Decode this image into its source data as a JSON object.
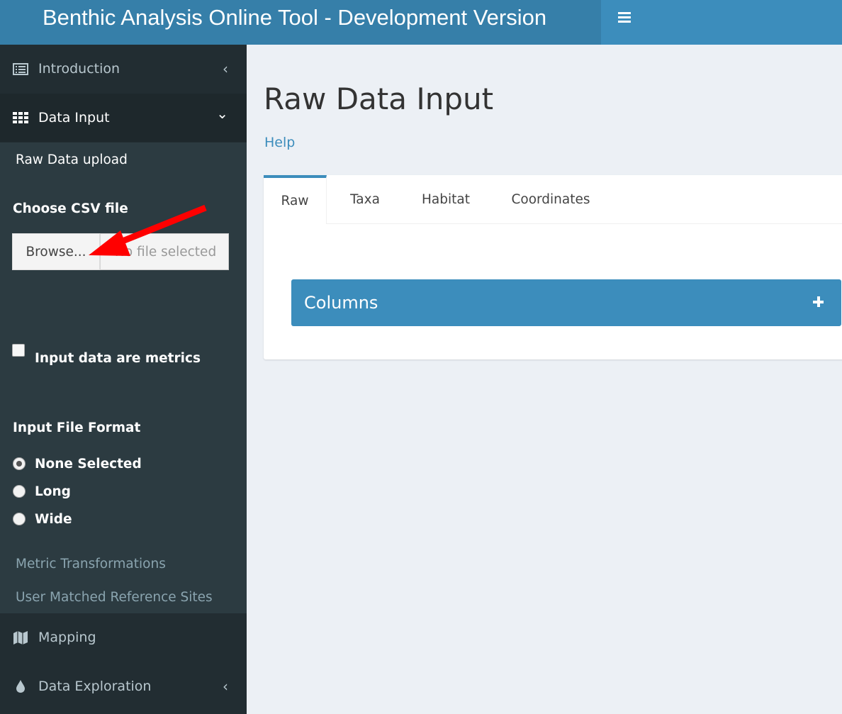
{
  "header": {
    "title": "Benthic Analysis Online Tool - Development Version",
    "menu_icon": "hamburger-icon"
  },
  "sidebar": {
    "items": [
      {
        "label": "Introduction",
        "icon": "list-icon",
        "chevron": "‹"
      },
      {
        "label": "Data Input",
        "icon": "table-icon",
        "chevron": "⌄"
      },
      {
        "label": "Mapping",
        "icon": "map-icon"
      },
      {
        "label": "Data Exploration",
        "icon": "droplet-icon",
        "chevron": "‹"
      }
    ],
    "data_input": {
      "raw_upload": "Raw Data upload",
      "csv_label": "Choose CSV file",
      "browse_label": "Browse...",
      "file_placeholder": "No file selected",
      "metrics_checkbox": "Input data are metrics",
      "format_label": "Input File Format",
      "format_options": [
        "None Selected",
        "Long",
        "Wide"
      ],
      "format_selected": "None Selected",
      "metric_transformations": "Metric Transformations",
      "user_matched": "User Matched Reference Sites"
    }
  },
  "main": {
    "title": "Raw Data Input",
    "help": "Help",
    "tabs": [
      "Raw",
      "Taxa",
      "Habitat",
      "Coordinates"
    ],
    "active_tab": "Raw",
    "columns_box": "Columns"
  },
  "colors": {
    "header": "#3c8dbc",
    "logo": "#367fa9",
    "sidebar": "#222d32",
    "submenu": "#2c3b41",
    "annotation_arrow": "#ff0000"
  }
}
